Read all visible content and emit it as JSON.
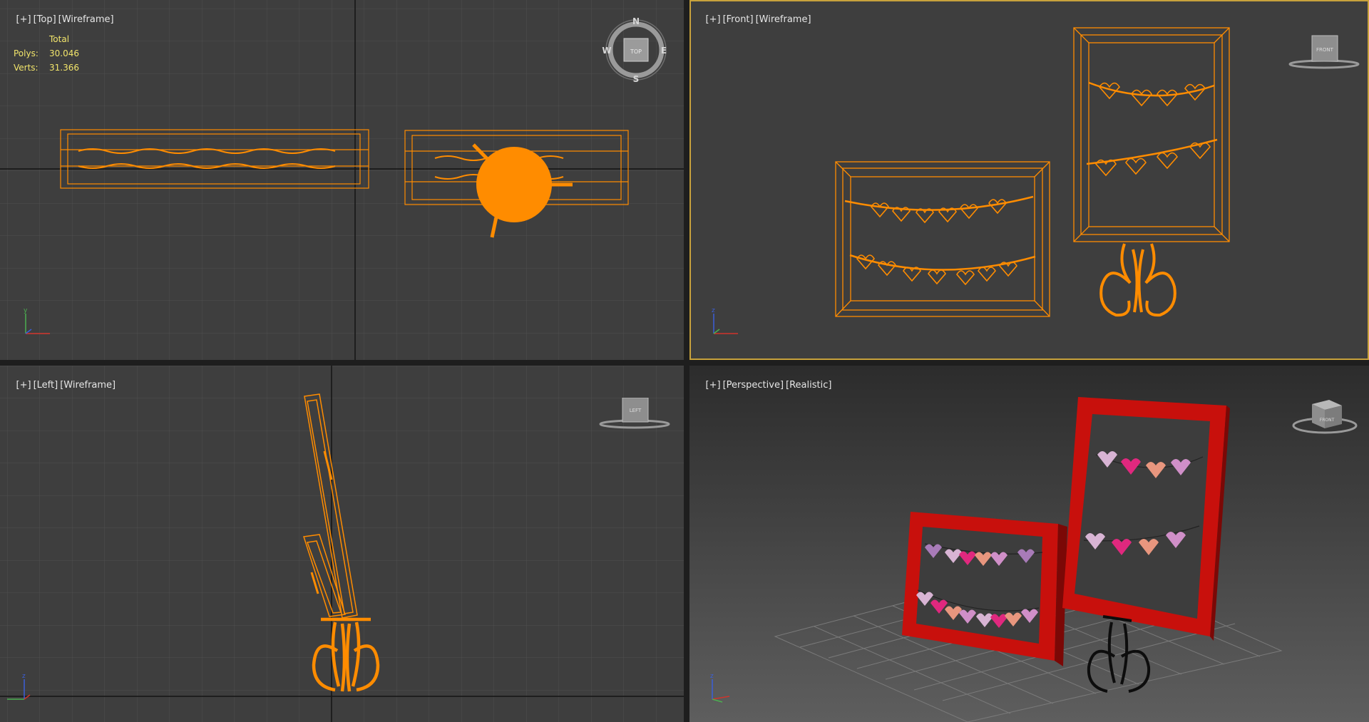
{
  "viewports": {
    "top": {
      "label": [
        "[+]",
        "[Top]",
        "[Wireframe]"
      ],
      "stats": {
        "header": "Total",
        "rows": [
          {
            "key": "Polys:",
            "value": "30.046"
          },
          {
            "key": "Verts:",
            "value": "31.366"
          }
        ]
      },
      "compass": {
        "n": "N",
        "s": "S",
        "e": "E",
        "w": "W",
        "cube": "TOP"
      },
      "axis": {
        "x": "x",
        "y": "y"
      }
    },
    "front": {
      "label": [
        "[+]",
        "[Front]",
        "[Wireframe]"
      ],
      "cube": "FRONT",
      "axis": {
        "x": "x",
        "z": "z"
      }
    },
    "left": {
      "label": [
        "[+]",
        "[Left]",
        "[Wireframe]"
      ],
      "cube": "LEFT",
      "axis": {
        "y": "y",
        "z": "z"
      }
    },
    "perspective": {
      "label": [
        "[+]",
        "[Perspective]",
        "[Realistic]"
      ],
      "cube": "FRONT",
      "axis": {
        "x": "x",
        "z": "z"
      }
    }
  },
  "colors": {
    "viewport_bg": "#3e3e3e",
    "grid": "#4f4f4f",
    "wire": "#ff8c00",
    "active_border": "#c8a23c",
    "stats": "#f2e56b",
    "frame_red": "#c8100c"
  }
}
